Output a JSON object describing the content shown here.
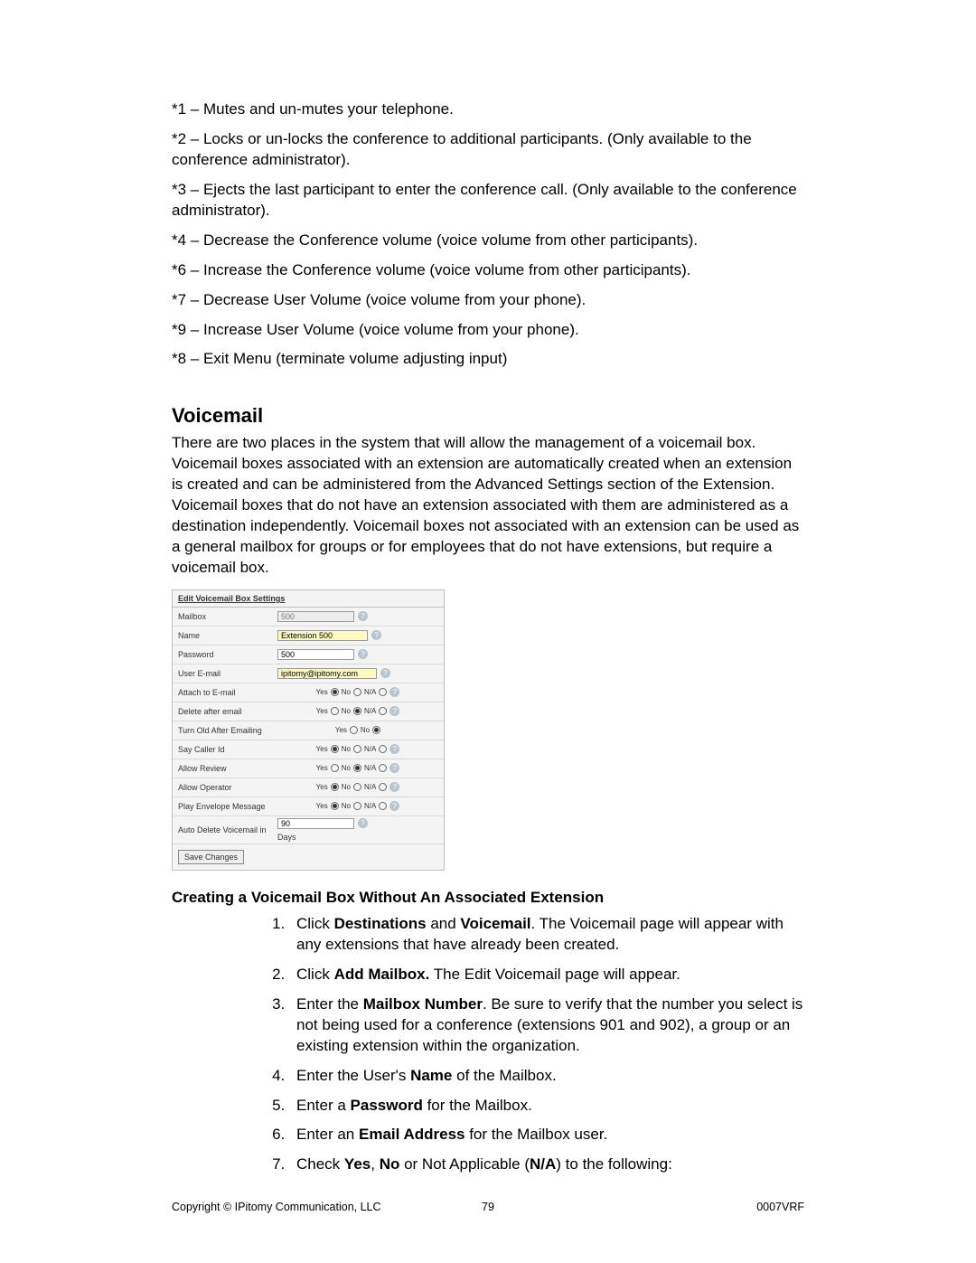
{
  "key_notes": [
    "*1 – Mutes and un-mutes your telephone.",
    "*2 – Locks or un-locks the conference to additional participants. (Only available to the conference administrator).",
    "*3 – Ejects the last participant to enter the conference call. (Only available to the conference administrator).",
    "*4 – Decrease the Conference volume (voice volume from other participants).",
    "*6 – Increase the Conference volume (voice volume from other participants).",
    "*7 – Decrease User Volume (voice volume from your phone).",
    "*9 – Increase User Volume (voice volume from your phone).",
    "*8 – Exit Menu (terminate volume adjusting input)"
  ],
  "voicemail": {
    "heading": "Voicemail",
    "intro": "There are two places in the system that will allow the management of a voicemail box. Voicemail boxes associated with an extension are automatically created when an extension is created and can be administered from the Advanced Settings section of the Extension. Voicemail boxes that do not have an extension associated with them are administered as a destination independently. Voicemail boxes not associated with an extension can be used as a general mailbox for groups or for employees that do not have extensions, but require a voicemail box."
  },
  "panel": {
    "title": "Edit Voicemail Box Settings",
    "rows": {
      "mailbox_label": "Mailbox",
      "mailbox_value": "500",
      "name_label": "Name",
      "name_value": "Extension 500",
      "password_label": "Password",
      "password_value": "500",
      "email_label": "User E-mail",
      "email_value": "ipitomy@ipitomy.com",
      "attach_label": "Attach to E-mail",
      "delete_label": "Delete after email",
      "turnold_label": "Turn Old After Emailing",
      "caller_label": "Say Caller Id",
      "review_label": "Allow Review",
      "operator_label": "Allow Operator",
      "envelope_label": "Play Envelope Message",
      "auto_del_label": "Auto Delete Voicemail in",
      "auto_del_value": "90",
      "auto_del_unit": "Days"
    },
    "opt_yes": "Yes",
    "opt_no": "No",
    "opt_na": "N/A",
    "save": "Save Changes"
  },
  "subhead": "Creating a Voicemail Box Without An Associated Extension",
  "steps": {
    "s1a": "Click ",
    "s1b": "Destinations",
    "s1c": " and ",
    "s1d": "Voicemail",
    "s1e": ". The Voicemail page will appear with any extensions that have already been created.",
    "s2a": "Click ",
    "s2b": "Add Mailbox.",
    "s2c": " The Edit Voicemail page will appear.",
    "s3a": "Enter the ",
    "s3b": "Mailbox Number",
    "s3c": ". Be sure to verify that the number you select is not being used for a conference (extensions 901 and 902), a group or an existing extension within the organization.",
    "s4a": "Enter the User's ",
    "s4b": "Name",
    "s4c": " of the Mailbox.",
    "s5a": "Enter a ",
    "s5b": "Password",
    "s5c": " for the Mailbox.",
    "s6a": "Enter an ",
    "s6b": "Email Address",
    "s6c": " for the Mailbox user.",
    "s7a": "Check ",
    "s7b": "Yes",
    "s7c": ", ",
    "s7d": "No",
    "s7e": " or Not Applicable (",
    "s7f": "N/A",
    "s7g": ") to the following:"
  },
  "footer": {
    "left": "Copyright © IPitomy Communication, LLC",
    "center": "79",
    "right": "0007VRF"
  }
}
